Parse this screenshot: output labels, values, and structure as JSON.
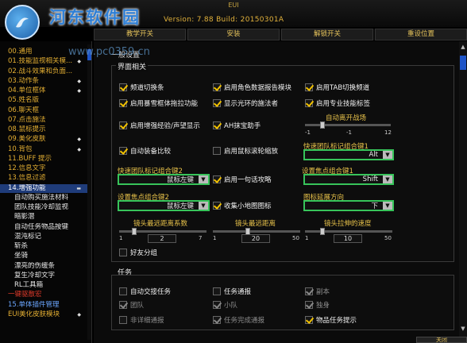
{
  "window": {
    "title": "EUI",
    "version_line": "Version: 7.88 Build: 20150301A"
  },
  "watermark": {
    "site_name": "河东软件园",
    "url": "www.pc0359.cn"
  },
  "tabs": [
    "教学开关",
    "安装",
    "解锁开关",
    "重设位置"
  ],
  "sidebar": {
    "items": [
      {
        "label": "00.通用",
        "style": "top"
      },
      {
        "label": "01.技能监视相关模...",
        "style": "top",
        "dot": true
      },
      {
        "label": "02.战斗效果和负面...",
        "style": "top"
      },
      {
        "label": "03.动作条",
        "style": "top",
        "dot": true
      },
      {
        "label": "04.单位框体",
        "style": "top",
        "dot": true
      },
      {
        "label": "05.姓名版",
        "style": "top"
      },
      {
        "label": "06.聊天框",
        "style": "top"
      },
      {
        "label": "07.点击施法",
        "style": "top"
      },
      {
        "label": "08.鼠标提示",
        "style": "top"
      },
      {
        "label": "09.美化皮肤",
        "style": "top",
        "dot": true
      },
      {
        "label": "10.背包",
        "style": "top",
        "dot": true
      },
      {
        "label": "11.BUFF 提示",
        "style": "top"
      },
      {
        "label": "12.信息文字",
        "style": "top"
      },
      {
        "label": "13.信息过滤",
        "style": "top"
      },
      {
        "label": "14.增强功能",
        "style": "active",
        "dot": true
      },
      {
        "label": "自动购买施法材料",
        "style": "sub"
      },
      {
        "label": "团队技能冷却监视",
        "style": "sub"
      },
      {
        "label": "暗影潜",
        "style": "sub"
      },
      {
        "label": "自动任务物品按键",
        "style": "sub"
      },
      {
        "label": "混沌标记",
        "style": "sub"
      },
      {
        "label": "斩杀",
        "style": "sub"
      },
      {
        "label": "坐骑",
        "style": "sub"
      },
      {
        "label": "漂亮的伤缓条",
        "style": "sub"
      },
      {
        "label": "复生冷却文字",
        "style": "sub"
      },
      {
        "label": "RL工具箱",
        "style": "sub"
      },
      {
        "label": "一键驱散宏",
        "style": "red"
      },
      {
        "label": "15.单体插件管理",
        "style": "blue"
      },
      {
        "label": "EUI美化皮肤模块",
        "style": "top",
        "dot": true
      }
    ]
  },
  "main": {
    "section_title": "一般设置",
    "ui_group": {
      "title": "界面相关",
      "checkboxes": [
        {
          "label": "频道切换条",
          "checked": true
        },
        {
          "label": "启用角色数据报告模块",
          "checked": true
        },
        {
          "label": "启用TAB切换频道",
          "checked": true
        },
        {
          "label": "启用暴雪框体拖拉功能",
          "checked": true
        },
        {
          "label": "显示光环的施法者",
          "checked": true
        },
        {
          "label": "启用专业技能标签",
          "checked": true
        },
        {
          "label": "启用增强经验/声望显示",
          "checked": true
        },
        {
          "label": "AH抹宝助手",
          "checked": true
        },
        {
          "label": "自动装备比较",
          "checked": true
        },
        {
          "label": "启用鼠标滚轮缩放",
          "checked": false
        },
        {
          "label": "启用一句话攻略",
          "checked": true
        },
        {
          "label": "收集小地图图标",
          "checked": true
        },
        {
          "label": "好友分组",
          "checked": false
        }
      ],
      "auto_leave": {
        "label": "自动离开战场",
        "min": "-1",
        "mid": "-1",
        "max": "12",
        "value": 0.2
      },
      "labels": {
        "quick_mark_1": "快速团队标记组合键1",
        "quick_mark_2": "快速团队标记组合键2",
        "focus_key_1": "设置焦点组合键1",
        "focus_key_2": "设置焦点组合键2",
        "icon_dir": "图标延展方向",
        "cam_lower": "镜头最远距离系数",
        "cam_far": "镜头最远距离",
        "cam_speed": "镜头拉伸的速度"
      },
      "dropdowns": {
        "quick_mark_1": "Alt",
        "quick_mark_2": "鼠标左键",
        "focus_key_1": "Shift",
        "focus_key_2": "鼠标左键",
        "icon_dir": "下"
      },
      "sliders": [
        {
          "min": "1",
          "max": "7",
          "value": "2",
          "fill": 0.17
        },
        {
          "min": "1",
          "max": "50",
          "value": "20",
          "fill": 0.4
        },
        {
          "min": "1",
          "max": "50",
          "value": "10",
          "fill": 0.2
        }
      ]
    },
    "task_group": {
      "title": "任务",
      "items": [
        {
          "label": "自动交接任务",
          "checked": false,
          "grey": false
        },
        {
          "label": "任务通报",
          "checked": false,
          "grey": false
        },
        {
          "label": "副本",
          "checked": true,
          "grey": true
        },
        {
          "label": "团队",
          "checked": true,
          "grey": true
        },
        {
          "label": "小队",
          "checked": true,
          "grey": true
        },
        {
          "label": "独身",
          "checked": true,
          "grey": true
        },
        {
          "label": "非详细通报",
          "checked": false,
          "grey": true
        },
        {
          "label": "任务完成通报",
          "checked": true,
          "grey": true
        },
        {
          "label": "物品任务提示",
          "checked": true,
          "grey": false
        }
      ]
    },
    "close_button": "关闭"
  },
  "colors": {
    "accent": "#e3ae32",
    "check": "#f2c200",
    "highlight": "#37c45a",
    "selected": "#1f3c7a"
  }
}
